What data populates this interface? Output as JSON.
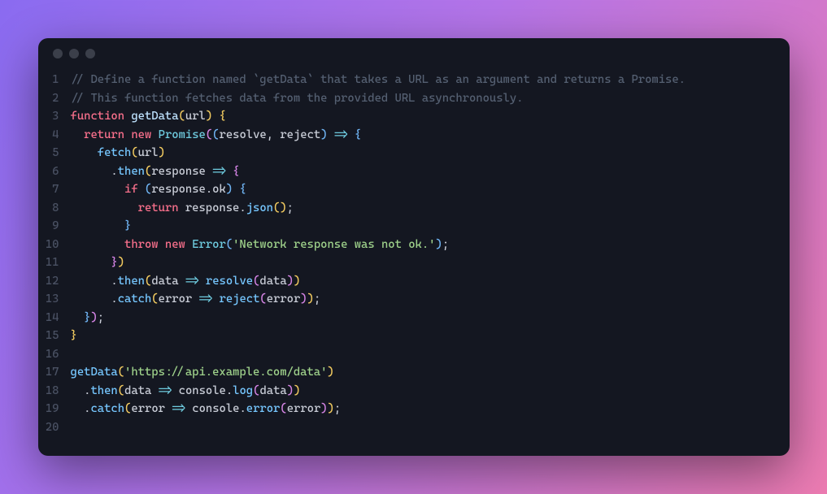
{
  "window": {
    "traffic_lights": 3
  },
  "code": {
    "lines": [
      {
        "n": "1",
        "t": [
          [
            "comment",
            "// Define a function named `getData` that takes a URL as an argument and returns a Promise."
          ]
        ]
      },
      {
        "n": "2",
        "t": [
          [
            "comment",
            "// This function fetches data from the provided URL asynchronously."
          ]
        ]
      },
      {
        "n": "3",
        "t": [
          [
            "keyword",
            "function"
          ],
          [
            "",
            " "
          ],
          [
            "def",
            "getData"
          ],
          [
            "paren",
            "("
          ],
          [
            "ident",
            "url"
          ],
          [
            "paren",
            ")"
          ],
          [
            "",
            " "
          ],
          [
            "paren",
            "{"
          ]
        ]
      },
      {
        "n": "4",
        "t": [
          [
            "",
            "  "
          ],
          [
            "keyword",
            "return"
          ],
          [
            "",
            " "
          ],
          [
            "keyword",
            "new"
          ],
          [
            "",
            " "
          ],
          [
            "class",
            "Promise"
          ],
          [
            "paren2",
            "("
          ],
          [
            "paren3",
            "("
          ],
          [
            "ident",
            "resolve"
          ],
          [
            "punct",
            ","
          ],
          [
            "",
            " "
          ],
          [
            "ident",
            "reject"
          ],
          [
            "paren3",
            ")"
          ],
          [
            "",
            " "
          ],
          [
            "op",
            "=>"
          ],
          [
            "",
            " "
          ],
          [
            "paren3",
            "{"
          ]
        ]
      },
      {
        "n": "5",
        "t": [
          [
            "",
            "    "
          ],
          [
            "func",
            "fetch"
          ],
          [
            "paren",
            "("
          ],
          [
            "ident",
            "url"
          ],
          [
            "paren",
            ")"
          ]
        ]
      },
      {
        "n": "6",
        "t": [
          [
            "",
            "      "
          ],
          [
            "punct",
            "."
          ],
          [
            "func",
            "then"
          ],
          [
            "paren",
            "("
          ],
          [
            "ident",
            "response"
          ],
          [
            "",
            " "
          ],
          [
            "op",
            "=>"
          ],
          [
            "",
            " "
          ],
          [
            "paren2",
            "{"
          ]
        ]
      },
      {
        "n": "7",
        "t": [
          [
            "",
            "        "
          ],
          [
            "keyword",
            "if"
          ],
          [
            "",
            " "
          ],
          [
            "paren3",
            "("
          ],
          [
            "ident",
            "response"
          ],
          [
            "punct",
            "."
          ],
          [
            "prop",
            "ok"
          ],
          [
            "paren3",
            ")"
          ],
          [
            "",
            " "
          ],
          [
            "paren3",
            "{"
          ]
        ]
      },
      {
        "n": "8",
        "t": [
          [
            "",
            "          "
          ],
          [
            "keyword",
            "return"
          ],
          [
            "",
            " "
          ],
          [
            "ident",
            "response"
          ],
          [
            "punct",
            "."
          ],
          [
            "func",
            "json"
          ],
          [
            "paren",
            "("
          ],
          [
            "paren",
            ")"
          ],
          [
            "punct",
            ";"
          ]
        ]
      },
      {
        "n": "9",
        "t": [
          [
            "",
            "        "
          ],
          [
            "paren3",
            "}"
          ]
        ]
      },
      {
        "n": "10",
        "t": [
          [
            "",
            "        "
          ],
          [
            "keyword",
            "throw"
          ],
          [
            "",
            " "
          ],
          [
            "keyword",
            "new"
          ],
          [
            "",
            " "
          ],
          [
            "class",
            "Error"
          ],
          [
            "paren3",
            "("
          ],
          [
            "string",
            "'Network response was not ok.'"
          ],
          [
            "paren3",
            ")"
          ],
          [
            "punct",
            ";"
          ]
        ]
      },
      {
        "n": "11",
        "t": [
          [
            "",
            "      "
          ],
          [
            "paren2",
            "}"
          ],
          [
            "paren",
            ")"
          ]
        ]
      },
      {
        "n": "12",
        "t": [
          [
            "",
            "      "
          ],
          [
            "punct",
            "."
          ],
          [
            "func",
            "then"
          ],
          [
            "paren",
            "("
          ],
          [
            "ident",
            "data"
          ],
          [
            "",
            " "
          ],
          [
            "op",
            "=>"
          ],
          [
            "",
            " "
          ],
          [
            "func",
            "resolve"
          ],
          [
            "paren2",
            "("
          ],
          [
            "ident",
            "data"
          ],
          [
            "paren2",
            ")"
          ],
          [
            "paren",
            ")"
          ]
        ]
      },
      {
        "n": "13",
        "t": [
          [
            "",
            "      "
          ],
          [
            "punct",
            "."
          ],
          [
            "func",
            "catch"
          ],
          [
            "paren",
            "("
          ],
          [
            "ident",
            "error"
          ],
          [
            "",
            " "
          ],
          [
            "op",
            "=>"
          ],
          [
            "",
            " "
          ],
          [
            "func",
            "reject"
          ],
          [
            "paren2",
            "("
          ],
          [
            "ident",
            "error"
          ],
          [
            "paren2",
            ")"
          ],
          [
            "paren",
            ")"
          ],
          [
            "punct",
            ";"
          ]
        ]
      },
      {
        "n": "14",
        "t": [
          [
            "",
            "  "
          ],
          [
            "paren3",
            "}"
          ],
          [
            "paren2",
            ")"
          ],
          [
            "punct",
            ";"
          ]
        ]
      },
      {
        "n": "15",
        "t": [
          [
            "paren",
            "}"
          ]
        ]
      },
      {
        "n": "16",
        "t": [
          [
            "",
            ""
          ]
        ]
      },
      {
        "n": "17",
        "t": [
          [
            "func",
            "getData"
          ],
          [
            "paren",
            "("
          ],
          [
            "string",
            "'https://api.example.com/data'"
          ],
          [
            "paren",
            ")"
          ]
        ]
      },
      {
        "n": "18",
        "t": [
          [
            "",
            "  "
          ],
          [
            "punct",
            "."
          ],
          [
            "func",
            "then"
          ],
          [
            "paren",
            "("
          ],
          [
            "ident",
            "data"
          ],
          [
            "",
            " "
          ],
          [
            "op",
            "=>"
          ],
          [
            "",
            " "
          ],
          [
            "ident",
            "console"
          ],
          [
            "punct",
            "."
          ],
          [
            "func",
            "log"
          ],
          [
            "paren2",
            "("
          ],
          [
            "ident",
            "data"
          ],
          [
            "paren2",
            ")"
          ],
          [
            "paren",
            ")"
          ]
        ]
      },
      {
        "n": "19",
        "t": [
          [
            "",
            "  "
          ],
          [
            "punct",
            "."
          ],
          [
            "func",
            "catch"
          ],
          [
            "paren",
            "("
          ],
          [
            "ident",
            "error"
          ],
          [
            "",
            " "
          ],
          [
            "op",
            "=>"
          ],
          [
            "",
            " "
          ],
          [
            "ident",
            "console"
          ],
          [
            "punct",
            "."
          ],
          [
            "func",
            "error"
          ],
          [
            "paren2",
            "("
          ],
          [
            "ident",
            "error"
          ],
          [
            "paren2",
            ")"
          ],
          [
            "paren",
            ")"
          ],
          [
            "punct",
            ";"
          ]
        ]
      },
      {
        "n": "20",
        "t": [
          [
            "",
            ""
          ]
        ]
      }
    ]
  }
}
